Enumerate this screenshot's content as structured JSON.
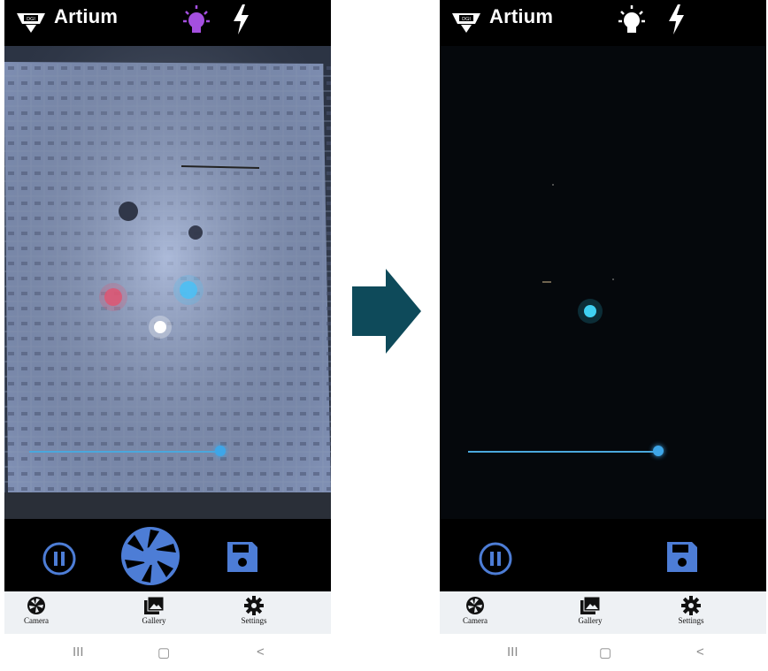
{
  "app": {
    "title": "Artium",
    "logo_text": "DGI"
  },
  "left_screen": {
    "bulb_color": "#a44fe0",
    "bolt_color": "#ffffff",
    "slider_value": 0.81,
    "controls": [
      "pause-button",
      "shutter-button",
      "save-button"
    ]
  },
  "right_screen": {
    "bulb_color": "#ffffff",
    "bolt_color": "#ffffff",
    "slider_value": 0.93,
    "controls": [
      "pause-button",
      "save-button"
    ]
  },
  "nav": {
    "camera_label": "Camera",
    "gallery_label": "Gallery",
    "settings_label": "Settings"
  },
  "system_nav": {
    "recents": "III",
    "home": "▢",
    "back": "<"
  },
  "colors": {
    "accent_blue": "#4d7dd6",
    "arrow_teal": "#0e4a5a",
    "slider_blue": "#3ea6e8"
  }
}
